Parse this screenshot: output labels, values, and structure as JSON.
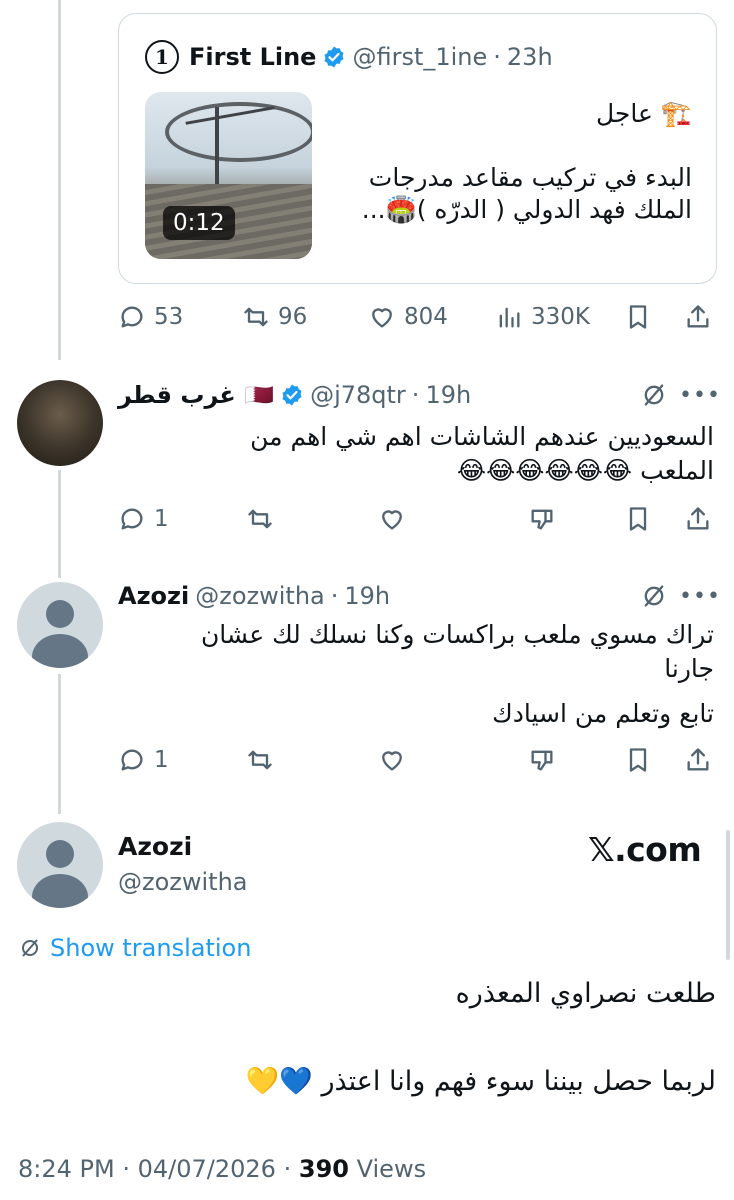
{
  "quoted_tweet": {
    "logo_char": "1",
    "name": "First Line",
    "handle": "@first_1ine",
    "separator": "·",
    "time": "23h",
    "video_duration": "0:12",
    "text_line1": "🏗️ عاجل",
    "text_line2": "البدء في تركيب مقاعد مدرجات",
    "text_line3": "الملك فهد الدولي ( الدرّه )🏟️...",
    "actions": {
      "replies": "53",
      "reposts": "96",
      "likes": "804",
      "views": "330K"
    }
  },
  "reply1": {
    "name": "غرب قطر 🇶🇦",
    "handle": "@j78qtr",
    "separator": "·",
    "time": "19h",
    "text": "السعوديين عندهم الشاشات اهم شي اهم من الملعب 😂😂😂😂😂😂",
    "actions": {
      "replies": "1"
    }
  },
  "reply2": {
    "name": "Azozi",
    "handle": "@zozwitha",
    "separator": "·",
    "time": "19h",
    "text_line1": "تراك مسوي ملعب براكسات وكنا نسلك لك عشان جارنا",
    "text_line2": "تابع وتعلم من اسيادك",
    "actions": {
      "replies": "1"
    }
  },
  "main_tweet": {
    "name": "Azozi",
    "handle": "@zozwitha",
    "brand": "𝕏.com",
    "show_translation": "Show translation",
    "text_line1": "طلعت نصراوي المعذره",
    "text_line2": "لربما حصل بيننا سوء فهم وانا اعتذر 💙💛",
    "time": "8:24 PM",
    "date": "04/07/2026",
    "separator": "·",
    "views_count": "390",
    "views_label": "Views"
  },
  "colors": {
    "verified": "#1d9bf0",
    "link": "#1d9bf0",
    "muted": "#536471",
    "line": "#cfd9de"
  }
}
